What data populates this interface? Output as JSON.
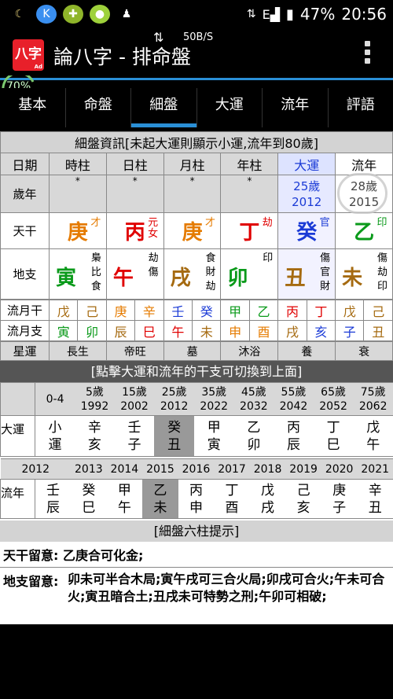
{
  "status_bar": {
    "signal_label": "E",
    "battery": "47%",
    "time": "20:56",
    "network_speed": "50B/S"
  },
  "app": {
    "logo_text": "八字",
    "logo_sub": "Ad",
    "title": "論八字 - 排命盤",
    "progress": "70%"
  },
  "tabs": [
    "基本",
    "命盤",
    "細盤",
    "大運",
    "流年",
    "評語"
  ],
  "active_tab": "細盤",
  "section_title": "細盤資訊[未起大運則顯示小運,流年到80歲]",
  "pillars": {
    "headers": [
      "日期",
      "時柱",
      "日柱",
      "月柱",
      "年柱",
      "大運",
      "流年"
    ],
    "age_label": "歲年",
    "age_row": [
      "*",
      "*",
      "*",
      "*"
    ],
    "dayun_age": "25歲",
    "dayun_year": "2012",
    "liunian_age": "28歲",
    "liunian_year": "2015",
    "tiangan_label": "天干",
    "tiangan": [
      {
        "char": "庚",
        "god": "才",
        "color": "#e57b00"
      },
      {
        "char": "丙",
        "god": "元女",
        "color": "#e00000"
      },
      {
        "char": "庚",
        "god": "才",
        "color": "#e57b00"
      },
      {
        "char": "丁",
        "god": "劫",
        "color": "#e00000"
      },
      {
        "char": "癸",
        "god": "官",
        "color": "#1b3bd6"
      },
      {
        "char": "乙",
        "god": "印",
        "color": "#0a9a1a"
      }
    ],
    "dizhi_label": "地支",
    "dizhi": [
      {
        "char": "寅",
        "gods": [
          "梟",
          "比",
          "食"
        ],
        "color": "#0a9a1a"
      },
      {
        "char": "午",
        "gods": [
          "劫",
          "傷"
        ],
        "color": "#e00000"
      },
      {
        "char": "戌",
        "gods": [
          "食",
          "財",
          "劫"
        ],
        "color": "#a56a10"
      },
      {
        "char": "卯",
        "gods": [
          "印"
        ],
        "color": "#0a9a1a"
      },
      {
        "char": "丑",
        "gods": [
          "傷",
          "官",
          "財"
        ],
        "color": "#a56a10"
      },
      {
        "char": "未",
        "gods": [
          "傷",
          "劫",
          "印"
        ],
        "color": "#a56a10"
      }
    ]
  },
  "liuyue_gan_label": "流月干",
  "liuyue_gan": [
    {
      "c": "戊",
      "col": "#a56a10"
    },
    {
      "c": "己",
      "col": "#a56a10"
    },
    {
      "c": "庚",
      "col": "#e57b00"
    },
    {
      "c": "辛",
      "col": "#e57b00"
    },
    {
      "c": "壬",
      "col": "#1b3bd6"
    },
    {
      "c": "癸",
      "col": "#1b3bd6"
    },
    {
      "c": "甲",
      "col": "#0a9a1a"
    },
    {
      "c": "乙",
      "col": "#0a9a1a"
    },
    {
      "c": "丙",
      "col": "#e00000"
    },
    {
      "c": "丁",
      "col": "#e00000"
    },
    {
      "c": "戊",
      "col": "#a56a10"
    },
    {
      "c": "己",
      "col": "#a56a10"
    }
  ],
  "liuyue_zhi_label": "流月支",
  "liuyue_zhi": [
    {
      "c": "寅",
      "col": "#0a9a1a"
    },
    {
      "c": "卯",
      "col": "#0a9a1a"
    },
    {
      "c": "辰",
      "col": "#a56a10"
    },
    {
      "c": "巳",
      "col": "#e00000"
    },
    {
      "c": "午",
      "col": "#e00000"
    },
    {
      "c": "未",
      "col": "#a56a10"
    },
    {
      "c": "申",
      "col": "#e57b00"
    },
    {
      "c": "酉",
      "col": "#e57b00"
    },
    {
      "c": "戌",
      "col": "#a56a10"
    },
    {
      "c": "亥",
      "col": "#1b3bd6"
    },
    {
      "c": "子",
      "col": "#1b3bd6"
    },
    {
      "c": "丑",
      "col": "#a56a10"
    }
  ],
  "xingyun_label": "星運",
  "xingyun": [
    "長生",
    "帝旺",
    "墓",
    "沐浴",
    "養",
    "衰"
  ],
  "click_hint": "[點擊大運和流年的干支可切換到上面]",
  "dayun_ages": [
    {
      "age": "0-4",
      "year": ""
    },
    {
      "age": "5歲",
      "year": "1992"
    },
    {
      "age": "15歲",
      "year": "2002"
    },
    {
      "age": "25歲",
      "year": "2012"
    },
    {
      "age": "35歲",
      "year": "2022"
    },
    {
      "age": "45歲",
      "year": "2032"
    },
    {
      "age": "55歲",
      "year": "2042"
    },
    {
      "age": "65歲",
      "year": "2052"
    },
    {
      "age": "75歲",
      "year": "2062"
    }
  ],
  "dayun_label": "大運",
  "dayun": [
    {
      "top": "小",
      "bot": "運"
    },
    {
      "top": "辛",
      "bot": "亥"
    },
    {
      "top": "壬",
      "bot": "子"
    },
    {
      "top": "癸",
      "bot": "丑"
    },
    {
      "top": "甲",
      "bot": "寅"
    },
    {
      "top": "乙",
      "bot": "卯"
    },
    {
      "top": "丙",
      "bot": "辰"
    },
    {
      "top": "丁",
      "bot": "巳"
    },
    {
      "top": "戊",
      "bot": "午"
    }
  ],
  "liunian_years": [
    "2012",
    "2013",
    "2014",
    "2015",
    "2016",
    "2017",
    "2018",
    "2019",
    "2020",
    "2021"
  ],
  "liunian_label": "流年",
  "liunian": [
    {
      "top": "壬",
      "bot": "辰"
    },
    {
      "top": "癸",
      "bot": "巳"
    },
    {
      "top": "甲",
      "bot": "午"
    },
    {
      "top": "乙",
      "bot": "未"
    },
    {
      "top": "丙",
      "bot": "申"
    },
    {
      "top": "丁",
      "bot": "酉"
    },
    {
      "top": "戊",
      "bot": "戌"
    },
    {
      "top": "己",
      "bot": "亥"
    },
    {
      "top": "庚",
      "bot": "子"
    },
    {
      "top": "辛",
      "bot": "丑"
    }
  ],
  "tips_title": "[細盤六柱提示]",
  "tips": {
    "tiangan_label": "天干留意:",
    "tiangan_text": "乙庚合可化金;",
    "dizhi_label": "地支留意:",
    "dizhi_text": "卯未可半合木局;寅午戌可三合火局;卯戌可合火;午未可合火;寅丑暗合土;丑戌未可特勢之刑;午卯可相破;"
  }
}
